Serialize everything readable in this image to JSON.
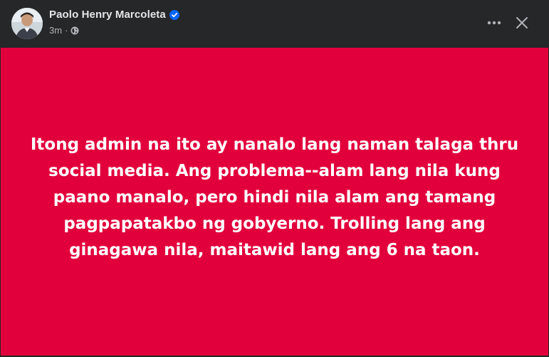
{
  "post": {
    "author": {
      "name": "Paolo Henry Marcoleta",
      "verified": true
    },
    "meta": {
      "time": "3m",
      "separator": "·",
      "audience_icon": "globe-icon"
    },
    "actions": {
      "more_icon": "more-horizontal-icon",
      "close_icon": "close-icon"
    },
    "body": {
      "text": "Itong admin na ito ay nanalo lang naman talaga thru social media. Ang problema--alam lang nila kung paano manalo, pero hindi nila alam ang tamang pagpapatakbo ng gobyerno. Trolling lang ang ginagawa nila, maitawid lang ang 6 na taon.",
      "background_color": "#e2003c",
      "text_color": "#ffffff"
    }
  },
  "colors": {
    "header_background": "#252728",
    "verified_badge": "#0866ff",
    "secondary_text": "#b0b3b8",
    "primary_text": "#e4e6eb"
  }
}
